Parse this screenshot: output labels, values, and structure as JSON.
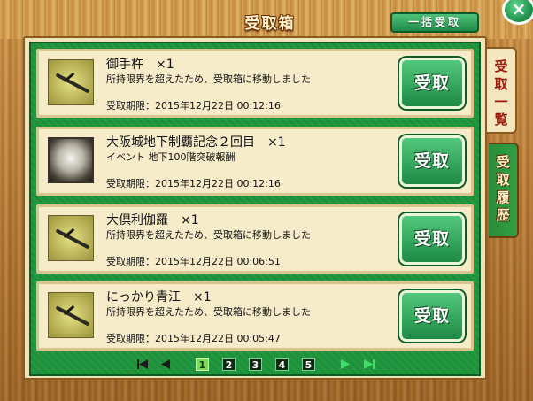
{
  "header": {
    "title": "受取箱",
    "bulk_receive_label": "一括受取",
    "close_label": "×"
  },
  "tabs": [
    {
      "label": [
        "受",
        "取",
        "一",
        "覧"
      ],
      "active": true
    },
    {
      "label": [
        "受",
        "取",
        "履",
        "歴"
      ],
      "active": false
    }
  ],
  "items": [
    {
      "name": "御手杵　×1",
      "desc": "所持限界を超えたため、受取箱に移動しました",
      "expiry": "受取期限：2015年12月22日 00:12:16",
      "thumb": "sword",
      "button": "受取"
    },
    {
      "name": "大阪城地下制覇記念２回目　×1",
      "desc": "イベント 地下100階突破報酬",
      "expiry": "受取期限：2015年12月22日 00:12:16",
      "thumb": "photo",
      "button": "受取"
    },
    {
      "name": "大倶利伽羅　×1",
      "desc": "所持限界を超えたため、受取箱に移動しました",
      "expiry": "受取期限：2015年12月22日 00:06:51",
      "thumb": "sword",
      "button": "受取"
    },
    {
      "name": "にっかり青江　×1",
      "desc": "所持限界を超えたため、受取箱に移動しました",
      "expiry": "受取期限：2015年12月22日 00:05:47",
      "thumb": "sword",
      "button": "受取"
    }
  ],
  "pagination": {
    "pages": [
      "1",
      "2",
      "3",
      "4",
      "5"
    ],
    "current": "1",
    "colors": {
      "arrow_dark": "#1a1a1a",
      "arrow_green": "#3fe06a",
      "current_bg": "#7ed957"
    }
  }
}
